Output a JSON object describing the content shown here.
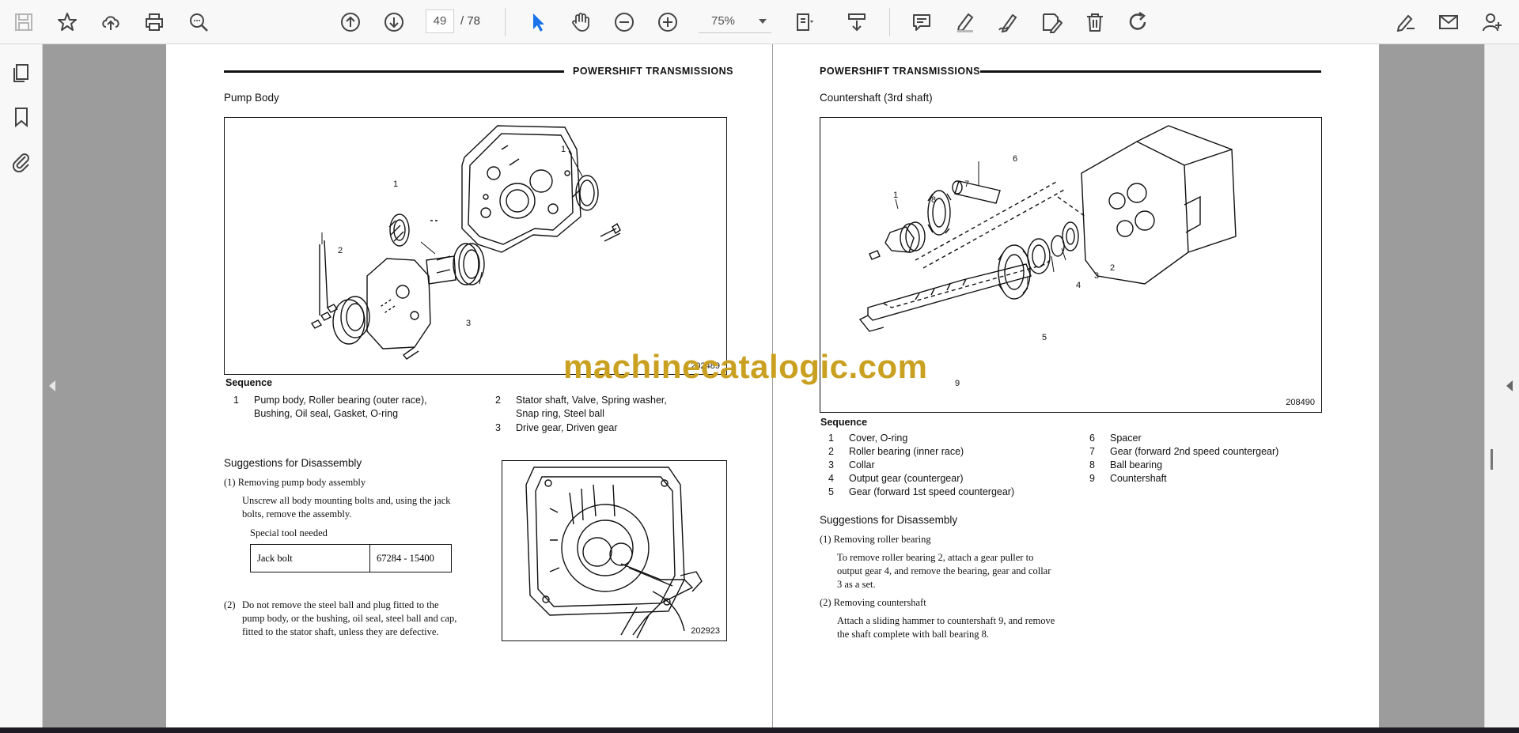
{
  "toolbar": {
    "page_current": "49",
    "page_total": "/ 78",
    "zoom": "75%",
    "icons": [
      "save-icon",
      "star-icon",
      "upload-icon",
      "print-icon",
      "zoom-search-icon",
      "page-up-icon",
      "page-down-icon",
      "select-cursor-icon",
      "hand-icon",
      "zoom-out-icon",
      "zoom-in-icon",
      "fit-page-icon",
      "scroll-mode-icon",
      "comment-icon",
      "highlight-icon",
      "draw-icon",
      "edit-icon",
      "delete-icon",
      "redo-icon",
      "sign-icon",
      "mail-icon",
      "add-user-icon"
    ]
  },
  "colors": {
    "accent": "#1a73e8",
    "watermark": "#caa020"
  },
  "watermark": "machinecatalogic.com",
  "page_left": {
    "header": "POWERSHIFT  TRANSMISSIONS",
    "section": "Pump Body",
    "figure_number": "202489",
    "callouts": [
      "1",
      "1",
      "2",
      "3"
    ],
    "sequence_heading": "Sequence",
    "sequence": [
      {
        "n": "1",
        "lines": [
          "Pump body, Roller bearing (outer race),",
          "Bushing, Oil seal, Gasket, O-ring"
        ]
      },
      {
        "n": "2",
        "lines": [
          "Stator shaft, Valve, Spring washer,",
          "Snap ring, Steel ball"
        ]
      },
      {
        "n": "3",
        "lines": [
          "Drive gear, Driven gear"
        ]
      }
    ],
    "suggestions_heading": "Suggestions for Disassembly",
    "step1_title": "(1)  Removing pump body assembly",
    "step1_text": [
      "Unscrew all body mounting bolts and, using the jack",
      "bolts, remove the assembly."
    ],
    "tool_label": "Special tool needed",
    "tool_name": "Jack bolt",
    "tool_code": "67284 - 15400",
    "step2_num": "(2)",
    "step2_text": [
      "Do not remove the steel ball and plug fitted to the",
      "pump body, or the bushing, oil seal, steel ball and cap,",
      "fitted to the stator shaft, unless they are defective."
    ],
    "figure2_number": "202923"
  },
  "page_right": {
    "header": "POWERSHIFT  TRANSMISSIONS",
    "section": "Countershaft (3rd shaft)",
    "figure_number": "208490",
    "callouts": [
      "1",
      "2",
      "3",
      "4",
      "5",
      "6",
      "7",
      "8",
      "9"
    ],
    "sequence_heading": "Sequence",
    "sequence_left": [
      {
        "n": "1",
        "text": "Cover, O-ring"
      },
      {
        "n": "2",
        "text": "Roller bearing (inner race)"
      },
      {
        "n": "3",
        "text": "Collar"
      },
      {
        "n": "4",
        "text": "Output gear (countergear)"
      },
      {
        "n": "5",
        "text": "Gear (forward 1st speed countergear)"
      }
    ],
    "sequence_right": [
      {
        "n": "6",
        "text": "Spacer"
      },
      {
        "n": "7",
        "text": "Gear (forward 2nd speed countergear)"
      },
      {
        "n": "8",
        "text": "Ball bearing"
      },
      {
        "n": "9",
        "text": "Countershaft"
      }
    ],
    "suggestions_heading": "Suggestions for Disassembly",
    "step1_title": "(1)  Removing roller bearing",
    "step1_text": [
      "To remove roller bearing 2, attach a gear puller to",
      "output gear 4, and remove the bearing, gear and collar",
      "3 as a set."
    ],
    "step2_title": "(2)  Removing countershaft",
    "step2_text": [
      "Attach a sliding hammer to countershaft 9, and remove",
      "the shaft complete with ball bearing 8."
    ]
  }
}
